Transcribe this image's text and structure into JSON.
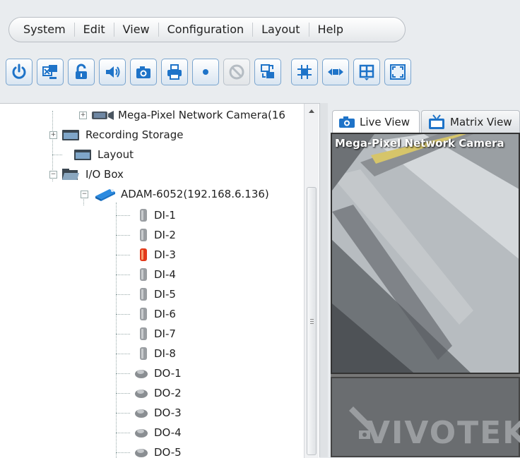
{
  "menu": [
    "System",
    "Edit",
    "View",
    "Configuration",
    "Layout",
    "Help"
  ],
  "toolbar": {
    "buttons": [
      {
        "icon": "power-icon",
        "enabled": true
      },
      {
        "icon": "remote-desktop-icon",
        "enabled": true
      },
      {
        "icon": "unlock-icon",
        "enabled": true
      },
      {
        "icon": "speaker-icon",
        "enabled": true
      },
      {
        "icon": "camera-snapshot-icon",
        "enabled": true
      },
      {
        "icon": "print-icon",
        "enabled": true
      },
      {
        "icon": "record-icon",
        "enabled": true
      },
      {
        "icon": "no-entry-icon",
        "enabled": false
      },
      {
        "icon": "network-switch-icon",
        "enabled": true
      },
      {
        "icon": "grid-adjust-icon",
        "enabled": true
      },
      {
        "icon": "ptz-arrows-icon",
        "enabled": true
      },
      {
        "icon": "quad-layout-icon",
        "enabled": true
      },
      {
        "icon": "fullscreen-icon",
        "enabled": true
      }
    ]
  },
  "tree": {
    "camera": "Mega-Pixel Network Camera(16",
    "recording_storage": "Recording Storage",
    "layout": "Layout",
    "io_box": "I/O Box",
    "device": "ADAM-6052(192.168.6.136)",
    "inputs": [
      {
        "label": "DI-1",
        "active": false
      },
      {
        "label": "DI-2",
        "active": false
      },
      {
        "label": "DI-3",
        "active": true
      },
      {
        "label": "DI-4",
        "active": false
      },
      {
        "label": "DI-5",
        "active": false
      },
      {
        "label": "DI-6",
        "active": false
      },
      {
        "label": "DI-7",
        "active": false
      },
      {
        "label": "DI-8",
        "active": false
      }
    ],
    "outputs": [
      "DO-1",
      "DO-2",
      "DO-3",
      "DO-4",
      "DO-5"
    ]
  },
  "tabs": {
    "live": "Live View",
    "matrix": "Matrix View"
  },
  "view": {
    "camera_title": "Mega-Pixel Network Camera",
    "logo": "VIVOTEK"
  },
  "colors": {
    "accent": "#1e73c8",
    "di_active": "#e23a1a",
    "di_inactive": "#9a9ea2"
  }
}
